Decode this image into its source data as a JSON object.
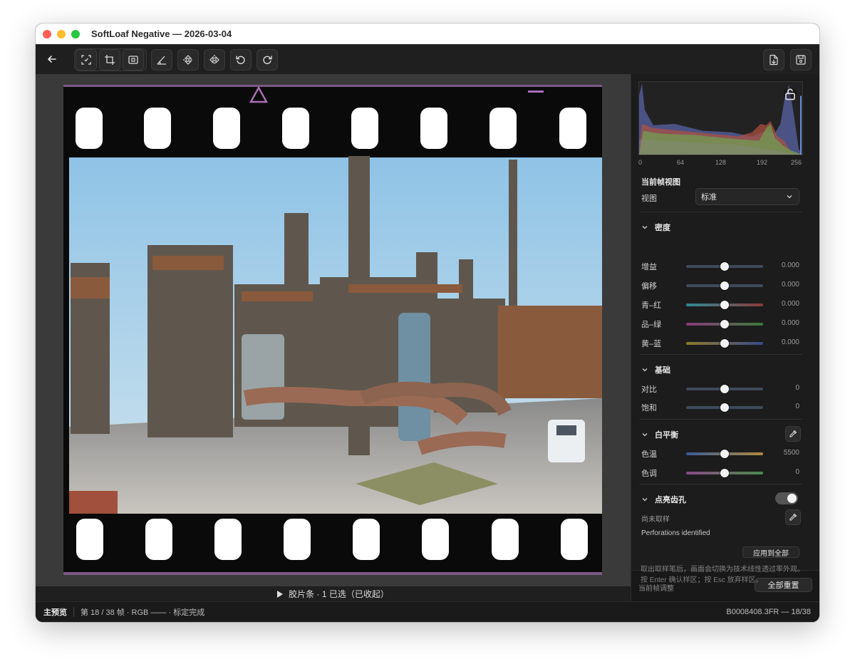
{
  "window": {
    "title": "SoftLoaf Negative — 2026-03-04"
  },
  "toolbar": {
    "icons": [
      "back-arrow-icon",
      "auto-detect-icon",
      "crop-icon",
      "frame-icon",
      "angle-icon",
      "flip-vertical-icon",
      "flip-horizontal-icon",
      "rotate-left-icon",
      "rotate-right-icon",
      "export-icon",
      "save-icon"
    ]
  },
  "histogram": {
    "ticks": [
      "0",
      "64",
      "128",
      "192",
      "256"
    ],
    "colors": {
      "red": "#c0403a",
      "green": "#5aa040",
      "blue": "#4060c0"
    }
  },
  "panel": {
    "current_view_title": "当前帧视图",
    "view_label": "视图",
    "view_value": "标准",
    "density": {
      "title": "密度",
      "rows": [
        {
          "label": "增益",
          "value": "0.000",
          "level": 0.5
        },
        {
          "label": "偏移",
          "value": "0.000",
          "level": 0.5
        },
        {
          "label": "青–红",
          "value": "0.000",
          "level": 0.5
        },
        {
          "label": "品–绿",
          "value": "0.000",
          "level": 0.5
        },
        {
          "label": "黄–蓝",
          "value": "0.000",
          "level": 0.5
        }
      ]
    },
    "basic": {
      "title": "基础",
      "rows": [
        {
          "label": "对比",
          "value": "0",
          "level": 0.5
        },
        {
          "label": "饱和",
          "value": "0",
          "level": 0.5
        }
      ]
    },
    "white_balance": {
      "title": "白平衡",
      "rows": [
        {
          "label": "色温",
          "value": "5500",
          "level": 0.5
        },
        {
          "label": "色调",
          "value": "0",
          "level": 0.5
        }
      ]
    },
    "perforations": {
      "title": "点亮齿孔",
      "toggle_on": true,
      "sample_status": "尚未取样",
      "identified_text": "Perforations identified",
      "apply_all": "应用到全部",
      "hint": "取出取样笔后，画面会切换为技术线性透过率外观。按 Enter 确认样区；按 Esc 放弃样区。"
    },
    "footer": {
      "label": "当前帧调整",
      "reset_all": "全部重置"
    }
  },
  "filmstrip": {
    "label": "胶片条 · 1 已选（已收起）"
  },
  "status": {
    "mode": "主预览",
    "frame_info": "第 18 / 38 帧 · RGB —— · 标定完成",
    "file": "B0008408.3FR — 18/38"
  }
}
